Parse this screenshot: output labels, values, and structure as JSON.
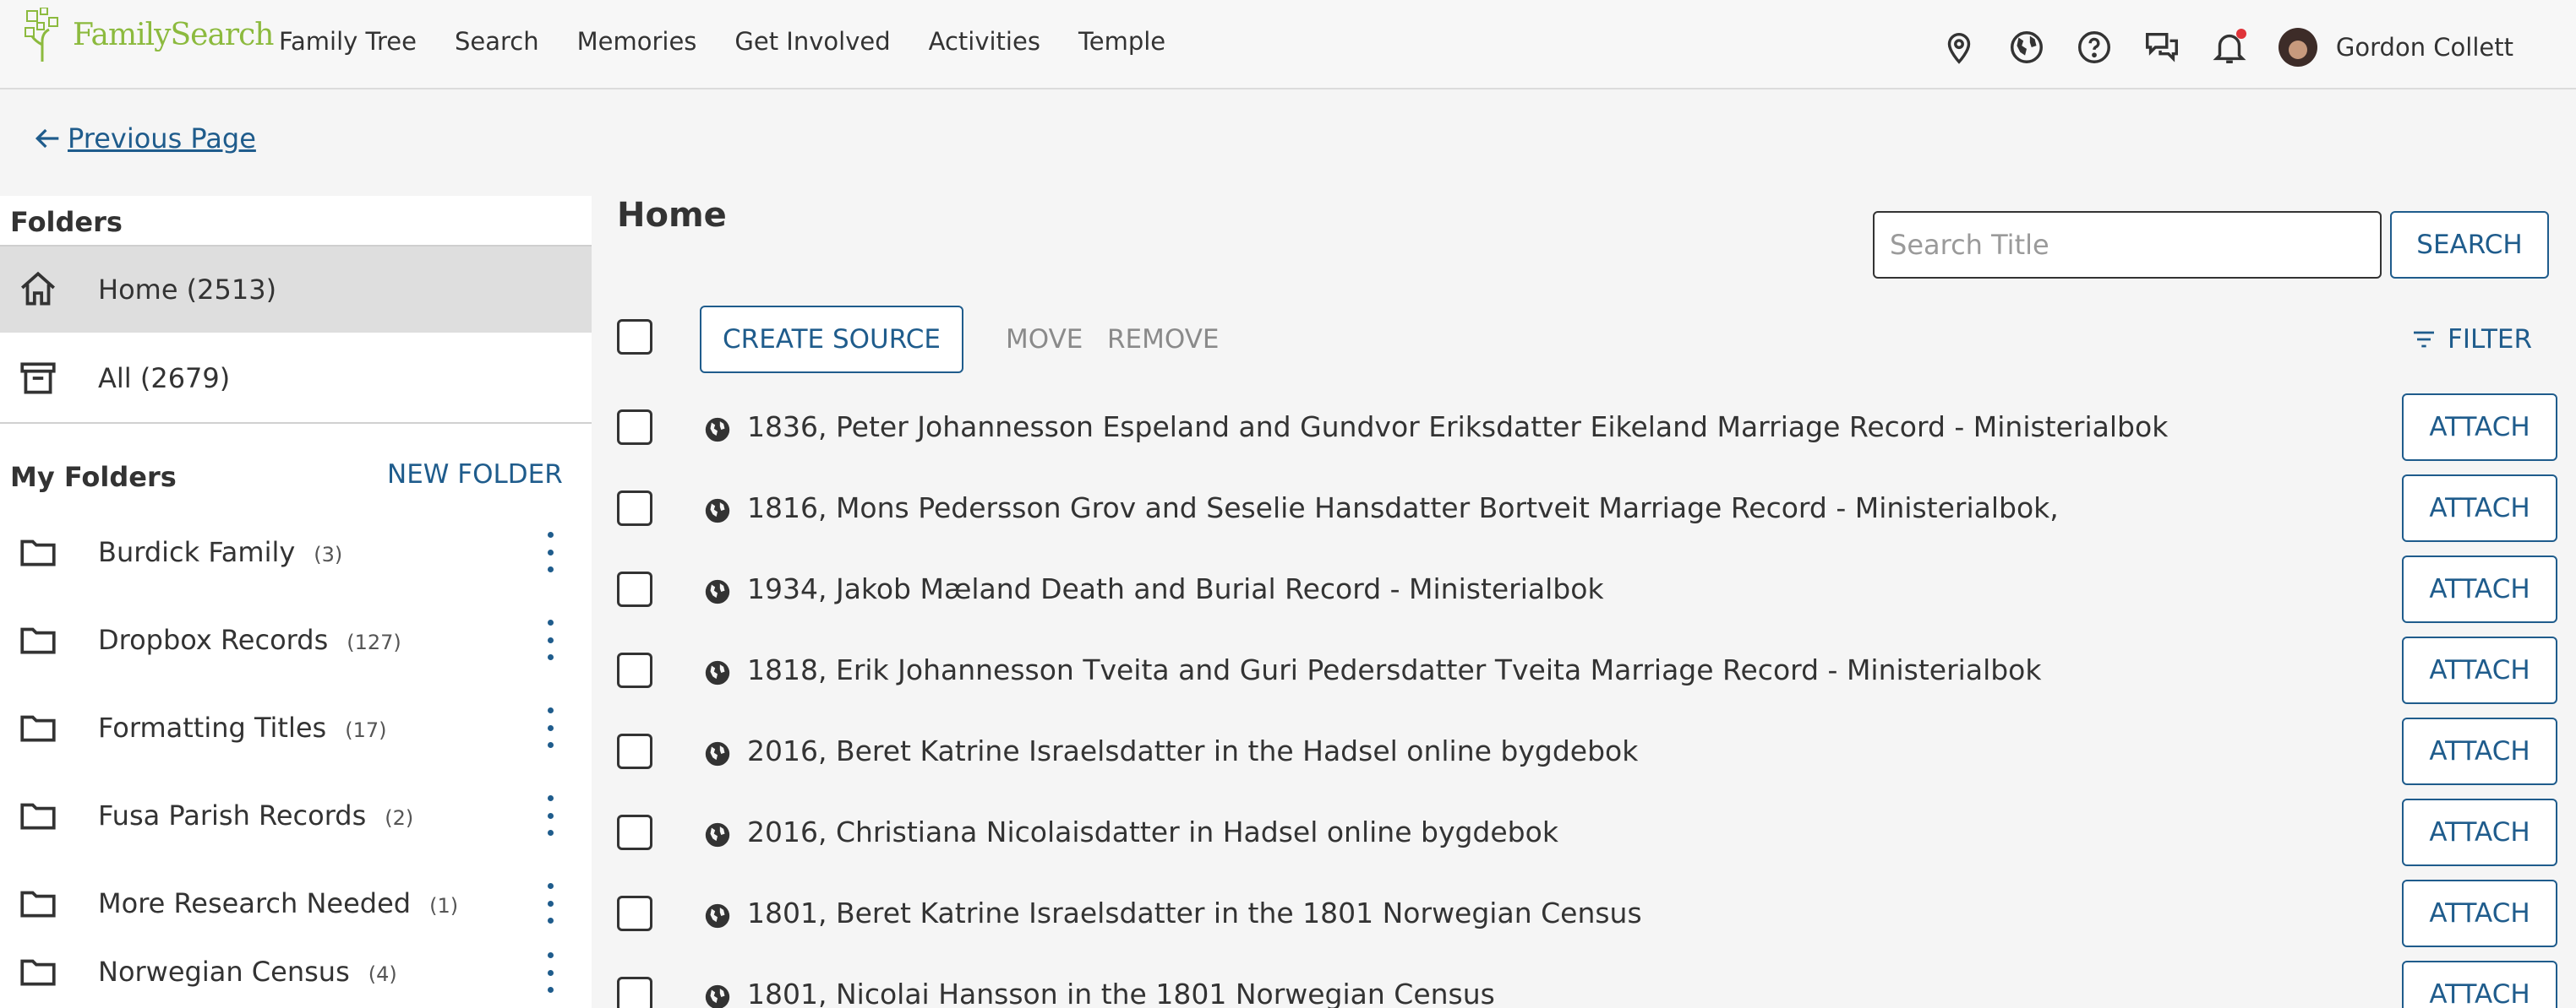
{
  "header": {
    "logo_text": "FamilySearch",
    "nav": [
      "Family Tree",
      "Search",
      "Memories",
      "Get Involved",
      "Activities",
      "Temple"
    ],
    "icons": [
      "location-pin-icon",
      "globe-icon",
      "help-icon",
      "messages-icon",
      "bell-icon"
    ],
    "user_name": "Gordon Collett"
  },
  "back_link": "Previous Page",
  "sidebar": {
    "title": "Folders",
    "home": "Home (2513)",
    "all": "All (2679)",
    "my_folders": "My Folders",
    "new_folder": "NEW FOLDER",
    "folders": [
      {
        "name": "Burdick Family",
        "count": "(3)"
      },
      {
        "name": "Dropbox Records",
        "count": "(127)"
      },
      {
        "name": "Formatting Titles",
        "count": "(17)"
      },
      {
        "name": "Fusa Parish Records",
        "count": "(2)"
      },
      {
        "name": "More Research Needed",
        "count": "(1)"
      },
      {
        "name": "Norwegian Census",
        "count": "(4)"
      }
    ]
  },
  "main": {
    "title": "Home",
    "search_placeholder": "Search Title",
    "search_button": "SEARCH",
    "create_source": "CREATE SOURCE",
    "move": "MOVE",
    "remove": "REMOVE",
    "filter": "FILTER",
    "attach_label": "ATTACH",
    "sources": [
      "1836, Peter Johannesson Espeland and Gundvor Eriksdatter Eikeland Marriage Record - Ministerialbok",
      "1816, Mons Pedersson Grov and Seselie Hansdatter Bortveit Marriage Record - Ministerialbok,",
      "1934, Jakob Mæland Death and Burial Record - Ministerialbok",
      "1818, Erik Johannesson Tveita and Guri Pedersdatter Tveita Marriage Record - Ministerialbok",
      "2016, Beret Katrine Israelsdatter in the Hadsel online bygdebok",
      "2016, Christiana Nicolaisdatter in Hadsel online bygdebok",
      "1801, Beret Katrine Israelsdatter in the 1801 Norwegian Census",
      "1801, Nicolai Hansson in the 1801 Norwegian Census"
    ]
  },
  "colors": {
    "brand_green": "#8cba3e",
    "link_blue": "#1f5c8c",
    "notification_red": "#e0343a"
  }
}
